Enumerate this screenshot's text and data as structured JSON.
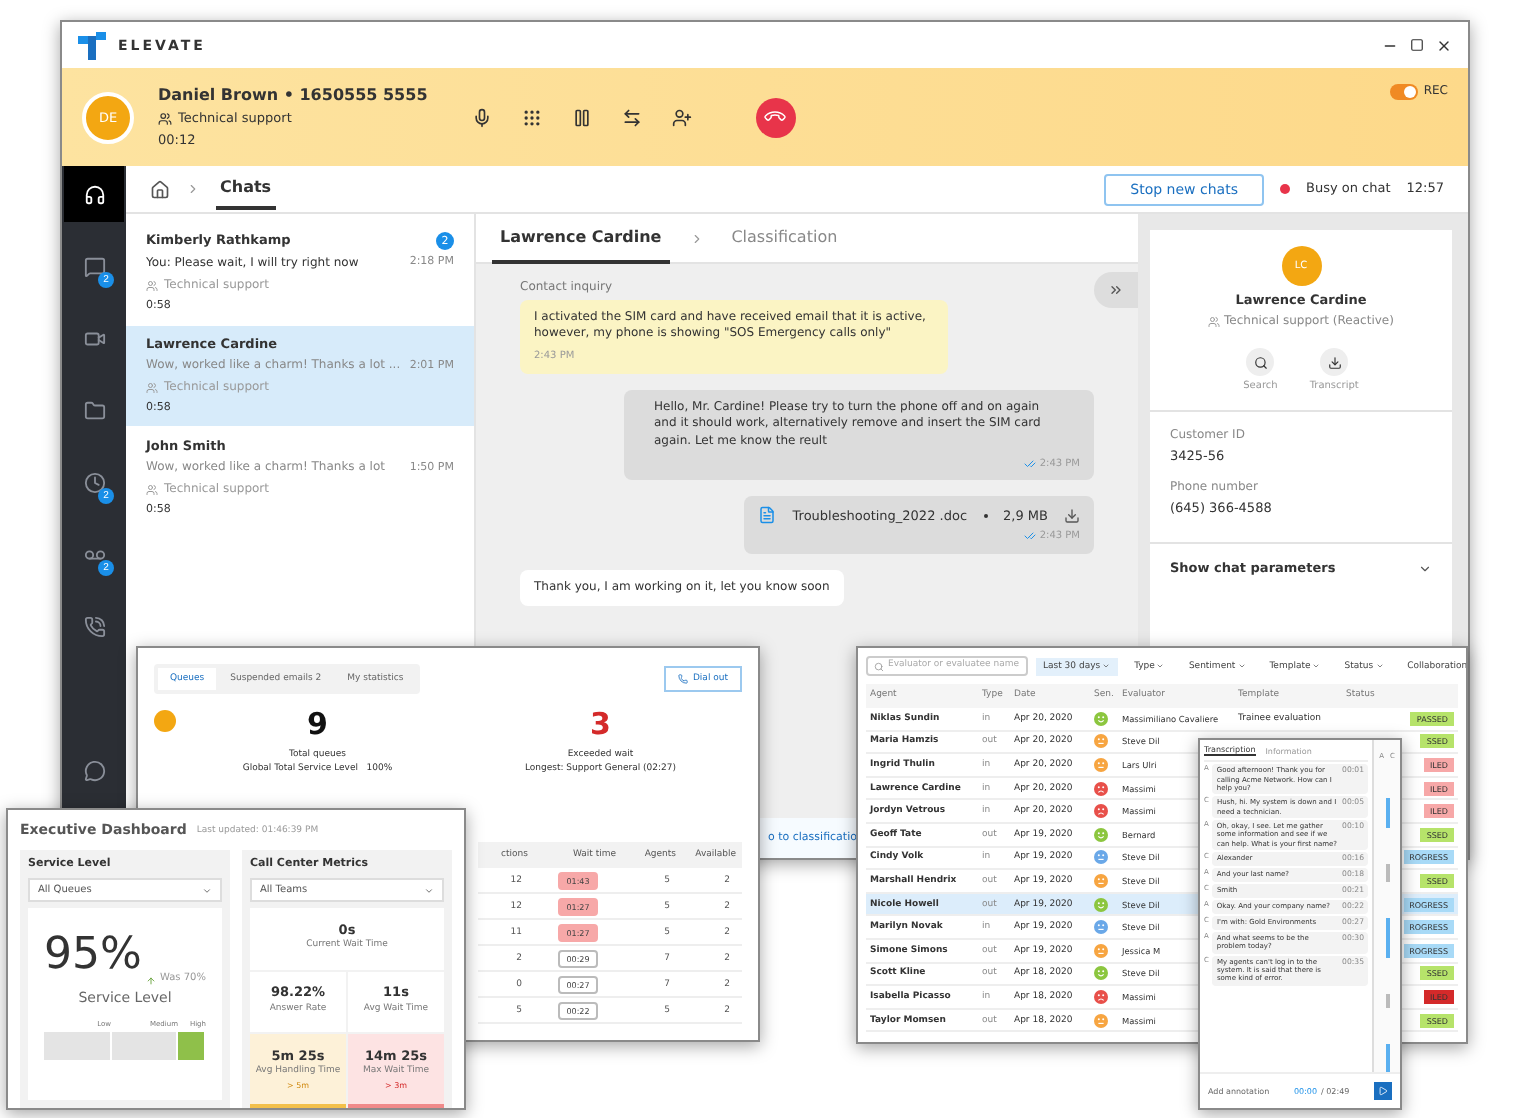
{
  "window": {
    "brand": "ELEVATE"
  },
  "call": {
    "initials": "DE",
    "caller": "Daniel Brown • 1650555 5555",
    "queue": "Technical support",
    "duration": "00:12",
    "rec_label": "REC",
    "recording": true
  },
  "nav": [
    {
      "kind": "headset",
      "selected": true
    },
    {
      "kind": "chat",
      "badge": "2",
      "selected": false
    },
    {
      "kind": "video",
      "selected": false
    },
    {
      "kind": "folder",
      "selected": false
    },
    {
      "kind": "clock",
      "badge": "2",
      "selected": false
    },
    {
      "kind": "voicemail",
      "badge": "2",
      "selected": false
    },
    {
      "kind": "phone",
      "selected": false
    },
    {
      "kind": "bubble",
      "selected": false
    }
  ],
  "topbar": {
    "crumb": "Chats",
    "stop_button": "Stop new chats",
    "status": "Busy on chat",
    "status_time": "12:57"
  },
  "chats": [
    {
      "name": "Kimberly Rathkamp",
      "preview": "You:  Please wait, I will try right now",
      "time": "2:18 PM",
      "queue": "Technical support",
      "duration": "0:58",
      "badge": "2",
      "selected": false
    },
    {
      "name": "Lawrence Cardine",
      "preview": "Wow, worked like a charm! Thanks a lot ...",
      "time": "2:01 PM",
      "queue": "Technical support",
      "duration": "0:58",
      "selected": true
    },
    {
      "name": "John Smith",
      "preview": "Wow, worked like a charm! Thanks a lot",
      "time": "1:50 PM",
      "queue": "Technical support",
      "duration": "0:58",
      "selected": false
    }
  ],
  "conversation": {
    "tabs": [
      {
        "label": "Lawrence Cardine",
        "selected": true
      },
      {
        "label": "Classification",
        "selected": false
      }
    ],
    "messages": [
      {
        "kind": "inquiry",
        "label": "Contact inquiry",
        "text": "I activated the SIM card and have received email that it is active, however, my phone is showing \"SOS Emergency calls only\"",
        "time": "2:43 PM"
      },
      {
        "kind": "agent",
        "text": "Hello, Mr. Cardine! Please try to turn the phone off and on again and it should work, alternatively remove and insert the SIM card again. Let me know the reult",
        "time": "2:43 PM"
      },
      {
        "kind": "file",
        "name": "Troubleshooting_2022 .doc",
        "size": "2,9 MB",
        "time": "2:43 PM"
      },
      {
        "kind": "customer",
        "text": "Thank you, I am working on it, let you know soon"
      }
    ],
    "footer_link": "o to classificatio"
  },
  "contact": {
    "initials": "LC",
    "name": "Lawrence Cardine",
    "queue": "Technical support (Reactive)",
    "actions": [
      {
        "kind": "search",
        "label": "Search"
      },
      {
        "kind": "download",
        "label": "Transcript"
      }
    ],
    "fields": [
      {
        "label": "Customer ID",
        "value": "3425-56"
      },
      {
        "label": "Phone number",
        "value": "(645) 366-4588"
      }
    ],
    "params": "Show chat parameters"
  },
  "queues_panel": {
    "tabs": [
      {
        "label": "Queues",
        "selected": true
      },
      {
        "label": "Suspended emails",
        "badge": "2",
        "selected": false
      },
      {
        "label": "My statistics",
        "selected": false
      }
    ],
    "dial_out": "Dial out",
    "stats": [
      {
        "kind": "normal",
        "value": "9",
        "label": "Total queues",
        "sub": "Global Total Service Level   100%"
      },
      {
        "kind": "alert",
        "value": "3",
        "label": "Exceeded wait",
        "sub": "Longest: Support General (02:27)"
      }
    ],
    "columns": [
      "ctions",
      "Wait time",
      "Agents",
      "Available"
    ],
    "rows": [
      {
        "interactions": "12",
        "wait": "01:43",
        "exceeded": true,
        "agents": "5",
        "available": "2"
      },
      {
        "interactions": "12",
        "wait": "01:27",
        "exceeded": true,
        "agents": "5",
        "available": "2"
      },
      {
        "interactions": "11",
        "wait": "01:27",
        "exceeded": true,
        "agents": "5",
        "available": "2"
      },
      {
        "interactions": "2",
        "wait": "00:29",
        "exceeded": false,
        "agents": "7",
        "available": "2"
      },
      {
        "interactions": "0",
        "wait": "00:27",
        "exceeded": false,
        "agents": "7",
        "available": "2"
      },
      {
        "interactions": "5",
        "wait": "00:22",
        "exceeded": false,
        "agents": "5",
        "available": "2"
      }
    ]
  },
  "dashboard": {
    "title": "Executive Dashboard",
    "updated": "Last updated: 01:46:39 PM",
    "service": {
      "title": "Service Level",
      "select": "All Queues",
      "value": "95%",
      "trend": "Was 70%",
      "label": "Service Level",
      "scale": [
        {
          "label": "Low",
          "selected": false
        },
        {
          "label": "Medium",
          "selected": false
        },
        {
          "label": "High",
          "selected": true
        }
      ]
    },
    "metrics": {
      "title": "Call Center Metrics",
      "select": "All Teams",
      "tiles": [
        {
          "kind": "wide",
          "value": "0s",
          "label": "Current Wait Time"
        },
        {
          "kind": "normal",
          "value": "98.22%",
          "label": "Answer Rate"
        },
        {
          "kind": "normal",
          "value": "11s",
          "label": "Avg Wait Time"
        },
        {
          "kind": "warning",
          "value": "5m 25s",
          "label": "Avg Handling Time",
          "note": "> 5m"
        },
        {
          "kind": "alert",
          "value": "14m 25s",
          "label": "Max Wait Time",
          "note": "> 3m"
        }
      ]
    }
  },
  "evaluations": {
    "search_placeholder": "Evaluator or evaluatee name",
    "filters": [
      {
        "label": "Last 30 days",
        "selected": true
      },
      {
        "label": "Type",
        "selected": false
      },
      {
        "label": "Sentiment",
        "selected": false
      },
      {
        "label": "Template",
        "selected": false
      },
      {
        "label": "Status",
        "selected": false
      },
      {
        "label": "Collaboration",
        "selected": false
      }
    ],
    "columns": [
      "Agent",
      "Type",
      "Date",
      "Sen.",
      "Evaluator",
      "Template",
      "Status"
    ],
    "rows": [
      {
        "agent": "Niklas Sundin",
        "type": "in",
        "date": "Apr 20, 2020",
        "kind": "positive",
        "color": "#8cc63f",
        "evaluator": "Massimiliano Cavaliere",
        "template": "Trainee evaluation",
        "status": {
          "text": "PASSED",
          "color": "#b6e36a"
        },
        "selected": false
      },
      {
        "agent": "Maria Hamzis",
        "type": "out",
        "date": "Apr 20, 2020",
        "kind": "neutral",
        "color": "#f7a541",
        "evaluator": "Steve Dil",
        "status": {
          "text": "SSED",
          "color": "#b6e36a"
        },
        "selected": false
      },
      {
        "agent": "Ingrid Thulin",
        "type": "in",
        "date": "Apr 20, 2020",
        "kind": "neutral",
        "color": "#f7a541",
        "evaluator": "Lars Ulri",
        "status": {
          "text": "ILED",
          "color": "#f7a8a8"
        },
        "selected": false
      },
      {
        "agent": "Lawrence Cardine",
        "type": "in",
        "date": "Apr 20, 2020",
        "kind": "negative",
        "color": "#e8504a",
        "evaluator": "Massimi",
        "status": {
          "text": "ILED",
          "color": "#f7a8a8"
        },
        "selected": false
      },
      {
        "agent": "Jordyn Vetrous",
        "type": "in",
        "date": "Apr 20, 2020",
        "kind": "negative",
        "color": "#e8504a",
        "evaluator": "Massimi",
        "status": {
          "text": "ILED",
          "color": "#f7a8a8"
        },
        "selected": false
      },
      {
        "agent": "Geoff Tate",
        "type": "out",
        "date": "Apr 19, 2020",
        "kind": "positive",
        "color": "#8cc63f",
        "evaluator": "Bernard",
        "status": {
          "text": "SSED",
          "color": "#b6e36a"
        },
        "selected": false
      },
      {
        "agent": "Cindy Volk",
        "type": "in",
        "date": "Apr 19, 2020",
        "kind": "neutral",
        "color": "#6aa8e8",
        "evaluator": "Steve Dil",
        "status": {
          "text": "ROGRESS",
          "color": "#a8daf7"
        },
        "selected": false
      },
      {
        "agent": "Marshall Hendrix",
        "type": "out",
        "date": "Apr 19, 2020",
        "kind": "neutral",
        "color": "#f7a541",
        "evaluator": "Steve Dil",
        "status": {
          "text": "SSED",
          "color": "#b6e36a"
        },
        "selected": false
      },
      {
        "agent": "Nicole Howell",
        "type": "out",
        "date": "Apr 19, 2020",
        "kind": "positive",
        "color": "#8cc63f",
        "evaluator": "Steve Dil",
        "status": {
          "text": "ROGRESS",
          "color": "#a8daf7"
        },
        "selected": true
      },
      {
        "agent": "Marilyn Novak",
        "type": "in",
        "date": "Apr 19, 2020",
        "kind": "neutral",
        "color": "#6aa8e8",
        "evaluator": "Steve Dil",
        "status": {
          "text": "ROGRESS",
          "color": "#a8daf7"
        },
        "selected": false
      },
      {
        "agent": "Simone Simons",
        "type": "out",
        "date": "Apr 19, 2020",
        "kind": "neutral",
        "color": "#f7a541",
        "evaluator": "Jessica M",
        "status": {
          "text": "ROGRESS",
          "color": "#a8daf7"
        },
        "selected": false
      },
      {
        "agent": "Scott Kline",
        "type": "out",
        "date": "Apr 18, 2020",
        "kind": "positive",
        "color": "#8cc63f",
        "evaluator": "Steve Dil",
        "status": {
          "text": "SSED",
          "color": "#b6e36a"
        },
        "selected": false
      },
      {
        "agent": "Isabella Picasso",
        "type": "in",
        "date": "Apr 18, 2020",
        "kind": "negative",
        "color": "#e8504a",
        "evaluator": "Massimi",
        "status": {
          "text": "ILED",
          "color": "#d42a2a"
        },
        "selected": false
      },
      {
        "agent": "Taylor Momsen",
        "type": "out",
        "date": "Apr 18, 2020",
        "kind": "neutral",
        "color": "#f7a541",
        "evaluator": "Massimi",
        "status": {
          "text": "SSED",
          "color": "#b6e36a"
        },
        "selected": false
      }
    ]
  },
  "transcript": {
    "tabs": [
      {
        "label": "Transcription",
        "selected": true
      },
      {
        "label": "Information",
        "selected": false
      }
    ],
    "columns": [
      "A",
      "C"
    ],
    "lines": [
      {
        "speaker": "A",
        "text": "Good afternoon! Thank you for calling Acme Network. How can I help you?",
        "time": "00:01"
      },
      {
        "speaker": "C",
        "text": "Hush, hi. My system is down and I need a technician.",
        "time": "00:05"
      },
      {
        "speaker": "A",
        "text": "Oh, okay, I see. Let me gather some information and see if we can help. What is your first name?",
        "time": "00:10"
      },
      {
        "speaker": "C",
        "text": "Alexander",
        "time": "00:16"
      },
      {
        "speaker": "A",
        "text": "And your last name?",
        "time": "00:18"
      },
      {
        "speaker": "C",
        "text": "Smith",
        "time": "00:21"
      },
      {
        "speaker": "A",
        "text": "Okay. And your company name?",
        "time": "00:22"
      },
      {
        "speaker": "C",
        "text": "I'm with: Gold Environments",
        "time": "00:27"
      },
      {
        "speaker": "A",
        "text": "And what seems to be the problem today?",
        "time": "00:30"
      },
      {
        "speaker": "C",
        "text": "My agents can't log in to the system. It is said that there is some kind of error.",
        "time": "00:35"
      }
    ],
    "footer": "Add annotation",
    "position": "00:00",
    "total": "/ 02:49"
  }
}
